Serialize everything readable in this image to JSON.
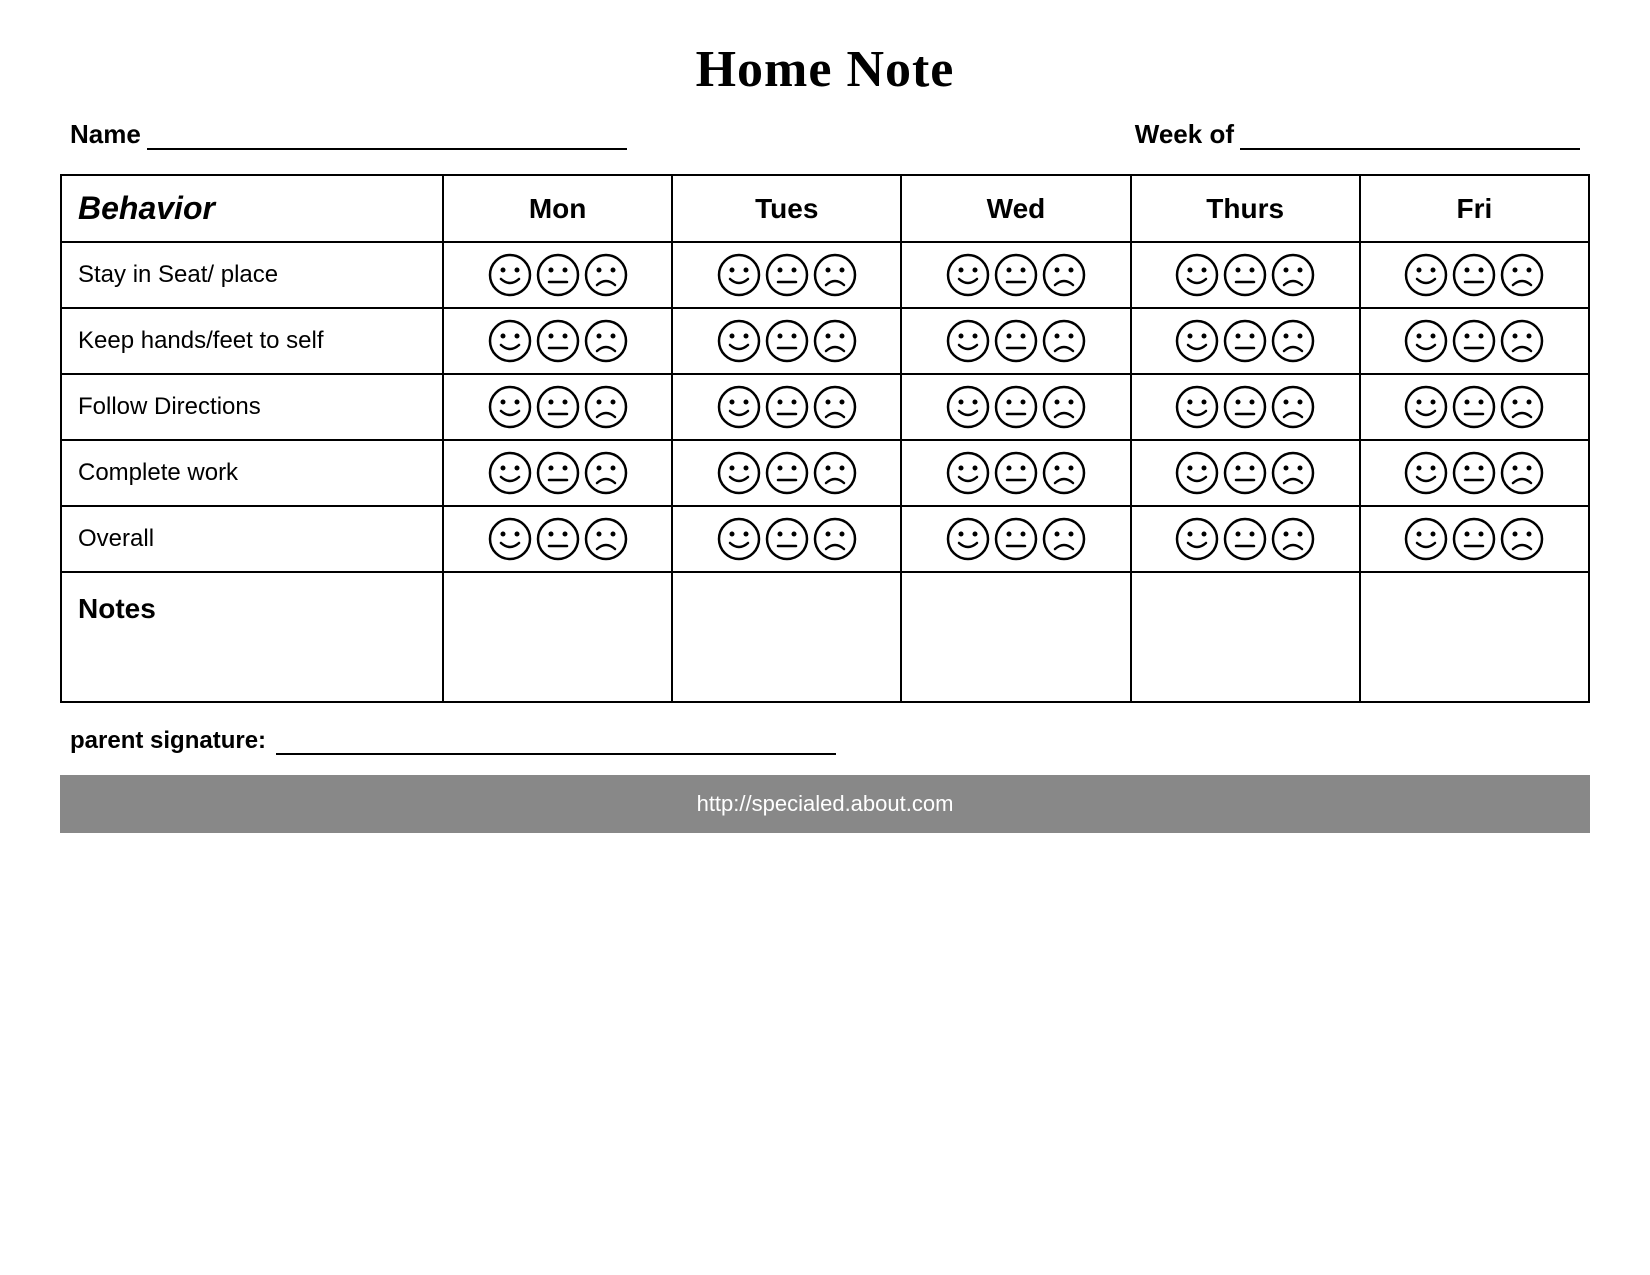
{
  "title": "Home Note",
  "name_label": "Name",
  "week_label": "Week of",
  "table": {
    "headers": {
      "behavior": "Behavior",
      "mon": "Mon",
      "tues": "Tues",
      "wed": "Wed",
      "thurs": "Thurs",
      "fri": "Fri"
    },
    "rows": [
      {
        "behavior": "Stay in Seat/ place"
      },
      {
        "behavior": "Keep hands/feet to self"
      },
      {
        "behavior": "Follow Directions"
      },
      {
        "behavior": "Complete work"
      },
      {
        "behavior": "Overall"
      }
    ],
    "notes_label": "Notes"
  },
  "footer": {
    "sig_label": "parent signature:",
    "url": "http://specialed.about.com"
  }
}
